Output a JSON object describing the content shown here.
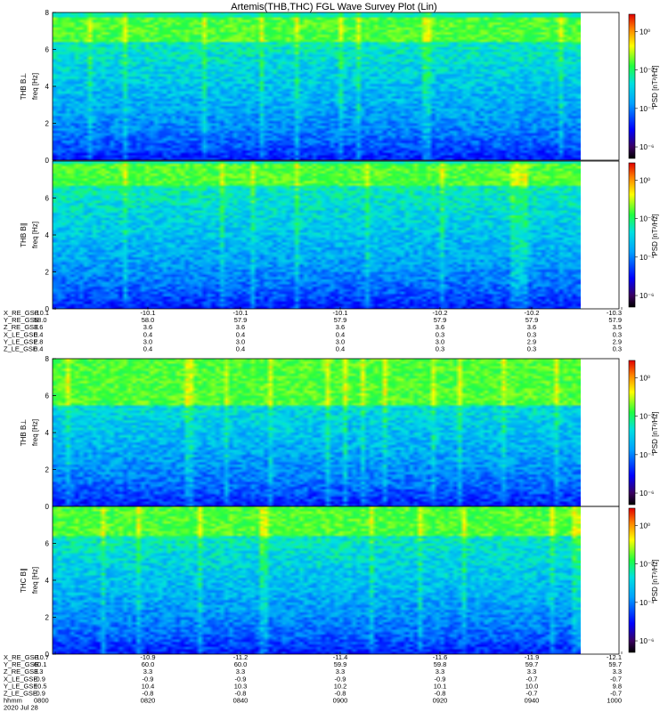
{
  "chart_data": {
    "type": "heatmap",
    "title": "Artemis(THB,THC) FGL Wave Survey Plot (Lin)",
    "panels": [
      {
        "ylabel": "THB B⊥",
        "yunit": "freq [Hz]",
        "ylim": [
          0,
          8
        ],
        "yticks": [
          "0",
          "2",
          "4",
          "6",
          "8"
        ],
        "colorbar": {
          "label": "PSD [nT²/Hz]",
          "ticks": [
            "10⁰",
            "10⁻²",
            "10⁻⁴",
            "10⁻⁶"
          ]
        },
        "bright_band_hz": [
          6.5,
          7.8
        ],
        "intensity": 0.55
      },
      {
        "ylabel": "THB B∥",
        "yunit": "freq [Hz]",
        "ylim": [
          0,
          8
        ],
        "yticks": [
          "0",
          "2",
          "4",
          "6"
        ],
        "colorbar": {
          "label": "PSD [nT²/Hz]",
          "ticks": [
            "10⁰",
            "10⁻²",
            "10⁻⁴",
            "10⁻⁶"
          ]
        },
        "bright_band_hz": [
          6.8,
          7.9
        ],
        "intensity": 0.4
      },
      {
        "ylabel": "THB B⊥",
        "yunit": "freq [Hz]",
        "ylim": [
          0,
          8
        ],
        "yticks": [
          "0",
          "2",
          "4",
          "6",
          "8"
        ],
        "colorbar": {
          "label": "PSD [nT²/Hz]",
          "ticks": [
            "10⁰",
            "10⁻²",
            "10⁻⁴",
            "10⁻⁶"
          ]
        },
        "bright_band_hz": [
          5.5,
          8.0
        ],
        "intensity": 0.5
      },
      {
        "ylabel": "THC B∥",
        "yunit": "freq [Hz]",
        "ylim": [
          0,
          8
        ],
        "yticks": [
          "0",
          "2",
          "4",
          "6"
        ],
        "colorbar": {
          "label": "PSD [nT²/Hz]",
          "ticks": [
            "10⁰",
            "10⁻²",
            "10⁻⁴",
            "10⁻⁶"
          ]
        },
        "bright_band_hz": [
          6.5,
          8.0
        ],
        "intensity": 0.4
      }
    ],
    "ephem_blocks": [
      {
        "rows": [
          {
            "label": "X_RE_GSE",
            "values": [
              "-10.1",
              "-10.1",
              "-10.1",
              "-10.1",
              "-10.2",
              "-10.2",
              "-10.3"
            ]
          },
          {
            "label": "Y_RE_GSE",
            "values": [
              "58.0",
              "58.0",
              "57.9",
              "57.9",
              "57.9",
              "57.9",
              "57.9"
            ]
          },
          {
            "label": "Z_RE_GSE",
            "values": [
              "3.6",
              "3.6",
              "3.6",
              "3.6",
              "3.6",
              "3.6",
              "3.5"
            ]
          },
          {
            "label": "X_LE_GSE",
            "values": [
              "0.4",
              "0.4",
              "0.4",
              "0.4",
              "0.3",
              "0.3",
              "0.3"
            ]
          },
          {
            "label": "Y_LE_GSE",
            "values": [
              "2.8",
              "3.0",
              "3.0",
              "3.0",
              "3.0",
              "2.9",
              "2.9"
            ]
          },
          {
            "label": "Z_LE_GSE",
            "values": [
              "0.4",
              "0.4",
              "0.4",
              "0.4",
              "0.3",
              "0.3",
              "0.3"
            ]
          }
        ]
      },
      {
        "rows": [
          {
            "label": "X_RE_GSE",
            "values": [
              "-10.7",
              "-10.9",
              "-11.2",
              "-11.4",
              "-11.6",
              "-11.9",
              "-12.1"
            ]
          },
          {
            "label": "Y_RE_GSE",
            "values": [
              "60.1",
              "60.0",
              "60.0",
              "59.9",
              "59.8",
              "59.7",
              "59.7"
            ]
          },
          {
            "label": "Z_RE_GSE",
            "values": [
              "3.3",
              "3.3",
              "3.3",
              "3.3",
              "3.3",
              "3.3",
              "3.3"
            ]
          },
          {
            "label": "X_LE_GSE",
            "values": [
              "-0.9",
              "-0.9",
              "-0.9",
              "-0.9",
              "-0.9",
              "-0.7",
              "-0.7"
            ]
          },
          {
            "label": "Y_LE_GSE",
            "values": [
              "10.5",
              "10.4",
              "10.3",
              "10.2",
              "10.1",
              "10.0",
              "9.8"
            ]
          },
          {
            "label": "Z_LE_GSE",
            "values": [
              "-0.9",
              "-0.8",
              "-0.8",
              "-0.8",
              "-0.8",
              "-0.7",
              "-0.7"
            ]
          },
          {
            "label": "hhmm",
            "values": [
              "0800",
              "0820",
              "0840",
              "0900",
              "0920",
              "0940",
              "1000"
            ]
          },
          {
            "label": "2020 Jul 28",
            "values": []
          }
        ]
      }
    ]
  }
}
